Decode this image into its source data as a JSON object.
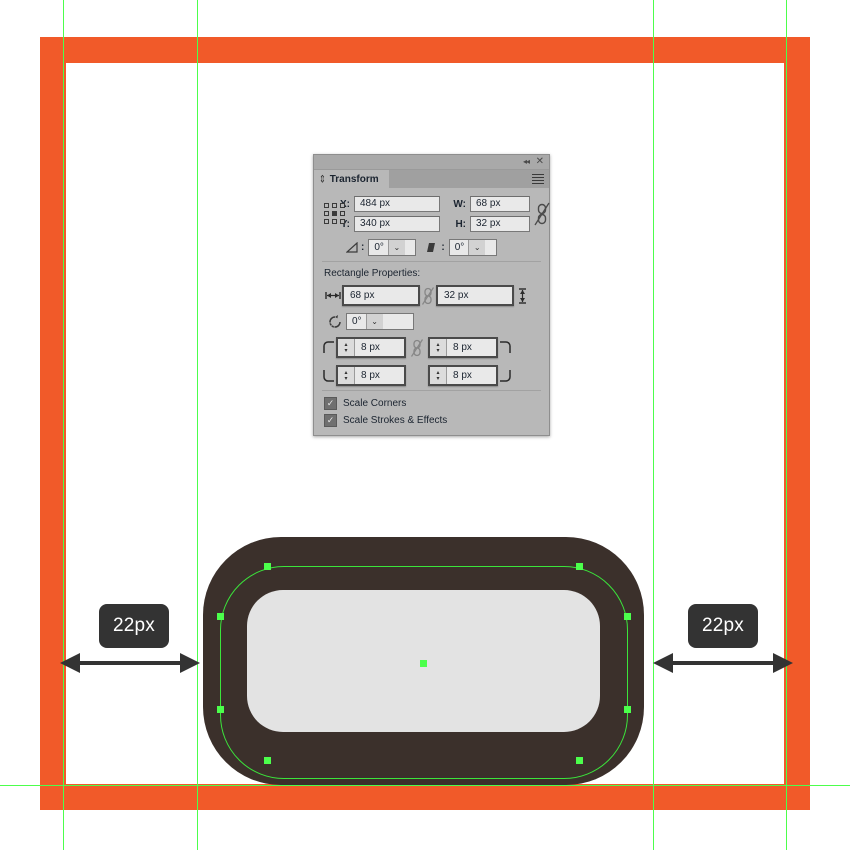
{
  "canvas": {
    "background_color": "#FFFFFF",
    "artboard_frame_color": "#F15A29",
    "guide_color": "#4CFF4C",
    "shape_fill_color": "#3B302B",
    "inner_shape_color": "#E3E3E3",
    "selection_color": "#3BE53B"
  },
  "measurements": {
    "left_label": "22px",
    "right_label": "22px"
  },
  "panel": {
    "title": "Transform",
    "titlebar": {
      "collapse_icon": "◂◂",
      "close_icon": "✕",
      "menu_icon": "panel-menu-icon"
    },
    "reference_point": {
      "label": "reference-point-grid",
      "selected": "center"
    },
    "transform_fields": {
      "x_label": "X:",
      "x_value": "484 px",
      "y_label": "Y:",
      "y_value": "340 px",
      "w_label": "W:",
      "w_value": "68 px",
      "h_label": "H:",
      "h_value": "32 px",
      "link_icon": "broken-link-icon"
    },
    "angle_row": {
      "shear_icon": "shear-angle-icon",
      "shear_separator": ":",
      "shear_value": "0°",
      "rotate_icon": "rotate-angle-icon",
      "rotate_separator": ":",
      "rotate_value": "0°",
      "dropdown_icon": "⌄"
    },
    "rectangle_properties": {
      "title": "Rectangle Properties:",
      "width_icon": "width-arrows-icon",
      "width_value": "68 px",
      "height_icon": "height-arrows-icon",
      "height_value": "32 px",
      "dimension_link_icon": "broken-link-icon",
      "rotation_icon": "rotation-icon",
      "rotation_value": "0°",
      "rotation_dropdown_icon": "⌄",
      "corner_link_icon": "broken-link-icon",
      "corners": [
        {
          "name": "top-left",
          "icon": "corner-top-left-icon",
          "value": "8 px"
        },
        {
          "name": "top-right",
          "icon": "corner-top-right-icon",
          "value": "8 px"
        },
        {
          "name": "bottom-left",
          "icon": "corner-bottom-left-icon",
          "value": "8 px"
        },
        {
          "name": "bottom-right",
          "icon": "corner-bottom-right-icon",
          "value": "8 px"
        }
      ],
      "checkboxes": [
        {
          "label": "Scale Corners",
          "checked": true
        },
        {
          "label": "Scale Strokes & Effects",
          "checked": true
        }
      ]
    }
  }
}
